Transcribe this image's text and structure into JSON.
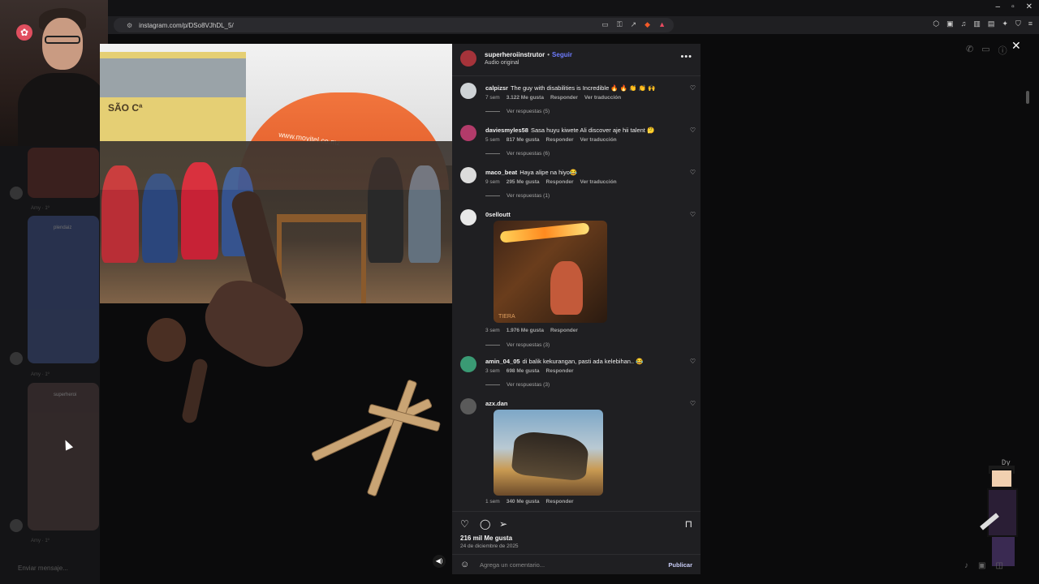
{
  "browser": {
    "url": "instagram.com/p/DSo8VJhDL_5/"
  },
  "post": {
    "image_overlay_text": {
      "building": "SÃO Cª",
      "umbrella": "www.movitel.co.mz"
    },
    "header": {
      "username": "superheroiinstrutor",
      "follow_label": "Seguir",
      "audio_label": "Audio original"
    },
    "comments": [
      {
        "user": "calpizsr",
        "text": "The guy with disabilities is Incredible 🔥 🔥 👏 👏 🙌",
        "time": "7 sem",
        "likes": "3.122 Me gusta",
        "reply": "Responder",
        "translate": "Ver traducción",
        "replies": "Ver respuestas (5)"
      },
      {
        "user": "daviesmyles58",
        "text": "Sasa huyu kiwete Ali discover aje hii talent 🤔",
        "time": "5 sem",
        "likes": "817 Me gusta",
        "reply": "Responder",
        "translate": "Ver traducción",
        "replies": "Ver respuestas (6)"
      },
      {
        "user": "maco_beat",
        "text": "Haya alipe na hiyo😂",
        "time": "9 sem",
        "likes": "295 Me gusta",
        "reply": "Responder",
        "translate": "Ver traducción",
        "replies": "Ver respuestas (1)"
      },
      {
        "user": "0selloutt",
        "text": "",
        "time": "3 sem",
        "likes": "1.976 Me gusta",
        "reply": "Responder",
        "translate": "",
        "replies": "Ver respuestas (3)",
        "media_caption": "TIERA"
      },
      {
        "user": "amin_04_05",
        "text": "di balik kekurangan, pasti ada kelebihan.. 😂",
        "time": "3 sem",
        "likes": "698 Me gusta",
        "reply": "Responder",
        "translate": "",
        "replies": "Ver respuestas (3)"
      },
      {
        "user": "azx.dan",
        "text": "",
        "time": "1 sem",
        "likes": "340 Me gusta",
        "reply": "Responder",
        "translate": "",
        "replies": ""
      }
    ],
    "likes_total": "216 mil Me gusta",
    "date": "24 de diciembre de 2025",
    "comment_placeholder": "Agrega un comentario...",
    "publish_label": "Publicar"
  },
  "chat": {
    "meta_1": "Amy · 1º",
    "meta_2": "Amy · 1º",
    "meta_3": "Amy · 1º",
    "thumb_label_1": "plendaiz",
    "thumb_label_2": "superheroi",
    "input_placeholder": "Enviar mensaje..."
  },
  "overlay": {
    "streamer_tag": "Dy"
  },
  "colors": {
    "panel_bg": "#1f1f22",
    "follow": "#6e7cff",
    "publish": "#c9cdf7"
  }
}
